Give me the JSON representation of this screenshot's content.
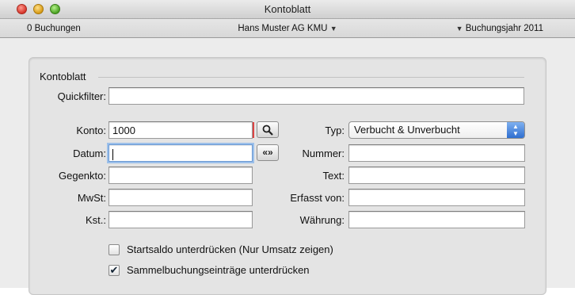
{
  "window": {
    "title": "Kontoblatt"
  },
  "infobar": {
    "count_label": "0 Buchungen",
    "company": "Hans Muster AG KMU",
    "company_arrow": "▼",
    "year_arrow": "▼",
    "year": "Buchungsjahr 2011"
  },
  "panel": {
    "section_title": "Kontoblatt",
    "quickfilter_label": "Quickfilter:",
    "quickfilter_value": "",
    "konto_label": "Konto:",
    "konto_value": "1000",
    "search_button_icon": "magnifier-icon",
    "datum_label": "Datum:",
    "datum_value": "",
    "datum_button_label": "«»",
    "gegenkto_label": "Gegenkto:",
    "gegenkto_value": "",
    "mwst_label": "MwSt:",
    "mwst_value": "",
    "kst_label": "Kst.:",
    "kst_value": "",
    "typ_label": "Typ:",
    "typ_value": "Verbucht & Unverbucht",
    "nummer_label": "Nummer:",
    "nummer_value": "",
    "text_label": "Text:",
    "text_value": "",
    "erfasst_label": "Erfasst von:",
    "erfasst_value": "",
    "waehrung_label": "Währung:",
    "waehrung_value": "",
    "checkboxes": [
      {
        "label": "Startsaldo unterdrücken (Nur Umsatz zeigen)",
        "checked": false
      },
      {
        "label": "Sammelbuchungseinträge unterdrücken",
        "checked": true
      }
    ]
  },
  "colors": {
    "focus_ring": "#9cc0ea",
    "select_accent": "#2f6fd0",
    "close": "#d6342a",
    "minimize": "#d79a14",
    "zoom": "#4aa222"
  }
}
